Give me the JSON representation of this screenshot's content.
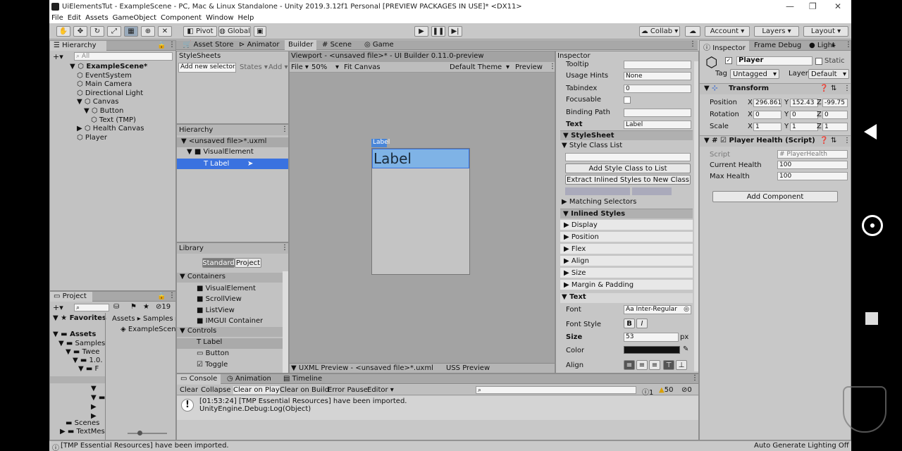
{
  "title": "UiElementsTut - ExampleScene - PC, Mac & Linux Standalone - Unity 2019.3.12f1 Personal [PREVIEW PACKAGES IN USE]* <DX11>",
  "window_controls": [
    "—",
    "❐",
    "✕"
  ],
  "menu": [
    "File",
    "Edit",
    "Assets",
    "GameObject",
    "Component",
    "Window",
    "Help"
  ],
  "toolbar": {
    "pivot": "Pivot",
    "global": "Global",
    "collab": "Collab ▾",
    "account": "Account ▾",
    "layers": "Layers ▾",
    "layout": "Layout ▾"
  },
  "hierarchy": {
    "tab": "Hierarchy",
    "search_placeholder": "All",
    "items": [
      {
        "label": "ExampleScene*",
        "depth": 0,
        "arrow": "▼",
        "bold": true
      },
      {
        "label": "EventSystem",
        "depth": 1,
        "arrow": ""
      },
      {
        "label": "Main Camera",
        "depth": 1,
        "arrow": ""
      },
      {
        "label": "Directional Light",
        "depth": 1,
        "arrow": ""
      },
      {
        "label": "Canvas",
        "depth": 1,
        "arrow": "▼"
      },
      {
        "label": "Button",
        "depth": 2,
        "arrow": "▼"
      },
      {
        "label": "Text (TMP)",
        "depth": 3,
        "arrow": ""
      },
      {
        "label": "Health Canvas",
        "depth": 1,
        "arrow": "▶"
      },
      {
        "label": "Player",
        "depth": 1,
        "arrow": ""
      }
    ]
  },
  "center_tabs": [
    "Asset Store",
    "Animator",
    "Builder",
    "Scene",
    "Game"
  ],
  "stylesheets": {
    "header": "StyleSheets",
    "add_selector": "Add new selector...",
    "states": "States ▾",
    "add": "Add ▾"
  },
  "builder_hierarchy": {
    "header": "Hierarchy",
    "items": [
      {
        "label": "<unsaved file>*.uxml",
        "depth": 0
      },
      {
        "label": "VisualElement",
        "depth": 1
      },
      {
        "label": "Label",
        "depth": 2
      }
    ]
  },
  "library": {
    "header": "Library",
    "tab_standard": "Standard",
    "tab_project": "Project",
    "containers_label": "Containers",
    "containers": [
      "VisualElement",
      "ScrollView",
      "ListView",
      "IMGUI Container"
    ],
    "controls_label": "Controls",
    "controls": [
      "Label",
      "Button",
      "Toggle"
    ]
  },
  "viewport": {
    "title": "Viewport - <unsaved file>* - UI Builder 0.11.0-preview",
    "file": "File ▾",
    "zoom": "50%",
    "fit": "Fit Canvas",
    "theme": "Default Theme",
    "preview": "Preview",
    "canvas_tag": "Label",
    "label_text": "Label",
    "uxml_preview": "UXML Preview - <unsaved file>*.uxml",
    "uss_preview": "USS Preview"
  },
  "builder_inspector": {
    "header": "Inspector",
    "attributes": [
      {
        "label": "Tooltip",
        "value": ""
      },
      {
        "label": "Usage Hints",
        "value": "None"
      },
      {
        "label": "Tabindex",
        "value": "0"
      },
      {
        "label": "Focusable",
        "value": ""
      },
      {
        "label": "Binding Path",
        "value": ""
      },
      {
        "label": "Text",
        "value": "Label"
      }
    ],
    "stylesheet": "StyleSheet",
    "style_class_list": "Style Class List",
    "add_style_class": "Add Style Class to List",
    "extract_inlined": "Extract Inlined Styles to New Class",
    "matching_selectors": "Matching Selectors",
    "inlined_styles": "Inlined Styles",
    "style_sections": [
      "Display",
      "Position",
      "Flex",
      "Align",
      "Size",
      "Margin & Padding"
    ],
    "text_section": "Text",
    "font_label": "Font",
    "font_value": "Inter-Regular",
    "font_style_label": "Font Style",
    "font_style_b": "B",
    "font_style_i": "I",
    "size_label": "Size",
    "size_value": "53",
    "size_unit": "px",
    "color_label": "Color",
    "color_value": "#111111",
    "align_label": "Align"
  },
  "project": {
    "tab": "Project",
    "count": "19",
    "favorites": "Favorites",
    "tree": [
      "Assets",
      "Samples",
      "Twee",
      "1.0.",
      "F"
    ],
    "bottom_tree": [
      "Scenes",
      "TextMes"
    ],
    "breadcrumb": [
      "Assets",
      "Samples"
    ],
    "file": "ExampleScene"
  },
  "console": {
    "tabs": [
      "Console",
      "Animation",
      "Timeline"
    ],
    "buttons": [
      "Clear",
      "Collapse",
      "Clear on Play",
      "Clear on Build",
      "Error Pause",
      "Editor ▾"
    ],
    "count_info": "1",
    "count_warn": "50",
    "count_error": "0",
    "message_line1": "[01:53:24] [TMP Essential Resources] have been imported.",
    "message_line2": "UnityEngine.Debug:Log(Object)"
  },
  "inspector": {
    "tabs": [
      "Inspector",
      "Frame Debug",
      "Light"
    ],
    "object_name": "Player",
    "static": "Static",
    "tag_label": "Tag",
    "tag_value": "Untagged",
    "layer_label": "Layer",
    "layer_value": "Default",
    "transform_title": "Transform",
    "rows": [
      {
        "label": "Position",
        "x": "296.861",
        "y": "152.43",
        "z": "-99.75"
      },
      {
        "label": "Rotation",
        "x": "0",
        "y": "0",
        "z": "0"
      },
      {
        "label": "Scale",
        "x": "1",
        "y": "1",
        "z": "1"
      }
    ],
    "script_component": "Player Health (Script)",
    "script_label": "Script",
    "script_value": "PlayerHealth",
    "current_health_label": "Current Health",
    "current_health": "100",
    "max_health_label": "Max Health",
    "max_health": "100",
    "add_component": "Add Component"
  },
  "status": {
    "message": "[TMP Essential Resources] have been imported.",
    "right": "Auto Generate Lighting Off"
  }
}
